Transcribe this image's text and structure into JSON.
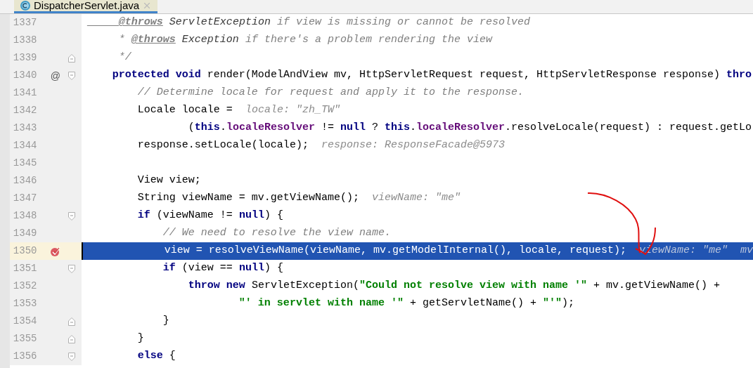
{
  "tabs": [
    {
      "label": "DispatcherServlet.java",
      "selected": true
    }
  ],
  "lines": [
    {
      "number": "1337",
      "selected": false,
      "tokens": [
        {
          "kind": "doctag",
          "t": "     @throws"
        },
        {
          "kind": "doc",
          "t": " ServletException"
        },
        {
          "kind": "comment",
          "t": " if view is missing or cannot be resolved"
        }
      ]
    },
    {
      "number": "1338",
      "selected": false,
      "tokens": [
        {
          "kind": "comment",
          "t": "     * "
        },
        {
          "kind": "doctag",
          "t": "@throws"
        },
        {
          "kind": "doc",
          "t": " Exception"
        },
        {
          "kind": "comment",
          "t": " if there's a problem rendering the view"
        }
      ]
    },
    {
      "number": "1339",
      "selected": false,
      "fold": {
        "kind": "end"
      },
      "tokens": [
        {
          "kind": "comment",
          "t": "     */"
        }
      ]
    },
    {
      "number": "1340",
      "selected": false,
      "marker": {
        "kind": "override",
        "text": "@"
      },
      "fold": {
        "kind": "start"
      },
      "tokens": [
        {
          "kind": "kw",
          "t": "    protected void"
        },
        {
          "kind": "plain",
          "t": " render(ModelAndView mv, HttpServletRequest request, HttpServletResponse response) "
        },
        {
          "kind": "kw",
          "t": "thro"
        }
      ]
    },
    {
      "number": "1341",
      "selected": false,
      "tokens": [
        {
          "kind": "comment",
          "t": "        // Determine locale for request and apply it to the response."
        }
      ]
    },
    {
      "number": "1342",
      "selected": false,
      "tokens": [
        {
          "kind": "plain",
          "t": "        Locale locale =  "
        },
        {
          "kind": "hint",
          "t": "locale: \"zh_TW\""
        }
      ]
    },
    {
      "number": "1343",
      "selected": false,
      "tokens": [
        {
          "kind": "plain",
          "t": "                ("
        },
        {
          "kind": "kw",
          "t": "this"
        },
        {
          "kind": "plain",
          "t": "."
        },
        {
          "kind": "field",
          "t": "localeResolver"
        },
        {
          "kind": "plain",
          "t": " != "
        },
        {
          "kind": "kw",
          "t": "null"
        },
        {
          "kind": "plain",
          "t": " ? "
        },
        {
          "kind": "kw",
          "t": "this"
        },
        {
          "kind": "plain",
          "t": "."
        },
        {
          "kind": "field",
          "t": "localeResolver"
        },
        {
          "kind": "plain",
          "t": ".resolveLocale(request) : request.getLo"
        }
      ]
    },
    {
      "number": "1344",
      "selected": false,
      "tokens": [
        {
          "kind": "plain",
          "t": "        response.setLocale(locale);  "
        },
        {
          "kind": "hint",
          "t": "response: ResponseFacade@5973"
        }
      ]
    },
    {
      "number": "1345",
      "selected": false
    },
    {
      "number": "1346",
      "selected": false,
      "tokens": [
        {
          "kind": "plain",
          "t": "        View view;"
        }
      ]
    },
    {
      "number": "1347",
      "selected": false,
      "tokens": [
        {
          "kind": "plain",
          "t": "        String viewName = mv.getViewName();  "
        },
        {
          "kind": "hint",
          "t": "viewName: \"me\""
        }
      ]
    },
    {
      "number": "1348",
      "selected": false,
      "fold": {
        "kind": "start"
      },
      "tokens": [
        {
          "kind": "kw",
          "t": "        if"
        },
        {
          "kind": "plain",
          "t": " (viewName != "
        },
        {
          "kind": "kw",
          "t": "null"
        },
        {
          "kind": "plain",
          "t": ") {"
        }
      ]
    },
    {
      "number": "1349",
      "selected": false,
      "tokens": [
        {
          "kind": "comment",
          "t": "            // We need to resolve the view name."
        }
      ]
    },
    {
      "number": "1350",
      "selected": true,
      "marker": {
        "kind": "breakpoint"
      },
      "tokens": [
        {
          "kind": "plain",
          "t": "            view = resolveViewName(viewName, mv.getModelInternal(), locale, request);  "
        },
        {
          "kind": "hint",
          "t": "viewName: \"me\"  mv"
        }
      ]
    },
    {
      "number": "1351",
      "selected": false,
      "fold": {
        "kind": "start"
      },
      "tokens": [
        {
          "kind": "kw",
          "t": "            if"
        },
        {
          "kind": "plain",
          "t": " (view == "
        },
        {
          "kind": "kw",
          "t": "null"
        },
        {
          "kind": "plain",
          "t": ") {"
        }
      ]
    },
    {
      "number": "1352",
      "selected": false,
      "tokens": [
        {
          "kind": "kw",
          "t": "                throw new"
        },
        {
          "kind": "plain",
          "t": " ServletException("
        },
        {
          "kind": "str",
          "t": "\"Could not resolve view with name '\""
        },
        {
          "kind": "plain",
          "t": " + mv.getViewName() +"
        }
      ]
    },
    {
      "number": "1353",
      "selected": false,
      "tokens": [
        {
          "kind": "str",
          "t": "                        \"' in servlet with name '\""
        },
        {
          "kind": "plain",
          "t": " + getServletName() + "
        },
        {
          "kind": "str",
          "t": "\"'\""
        },
        {
          "kind": "plain",
          "t": ");"
        }
      ]
    },
    {
      "number": "1354",
      "selected": false,
      "fold": {
        "kind": "end"
      },
      "tokens": [
        {
          "kind": "plain",
          "t": "            }"
        }
      ]
    },
    {
      "number": "1355",
      "selected": false,
      "fold": {
        "kind": "end"
      },
      "tokens": [
        {
          "kind": "plain",
          "t": "        }"
        }
      ]
    },
    {
      "number": "1356",
      "selected": false,
      "fold": {
        "kind": "start"
      },
      "tokens": [
        {
          "kind": "kw",
          "t": "        else"
        },
        {
          "kind": "plain",
          "t": " {"
        }
      ]
    }
  ]
}
